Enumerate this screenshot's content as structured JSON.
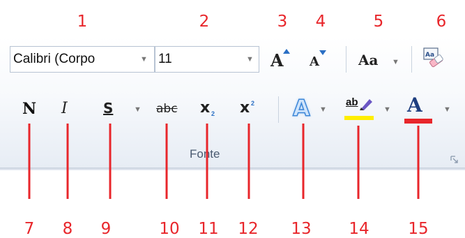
{
  "callout_numbers": [
    "1",
    "2",
    "3",
    "4",
    "5",
    "6",
    "7",
    "8",
    "9",
    "10",
    "11",
    "12",
    "13",
    "14",
    "15"
  ],
  "font": {
    "name_value": "Calibri (Corpo",
    "size_value": "11"
  },
  "buttons": {
    "grow_font_glyph": "A",
    "shrink_font_glyph": "A",
    "change_case_label": "Aa",
    "bold_label": "N",
    "italic_label": "I",
    "underline_label": "S",
    "strikethrough_label": "abc",
    "subscript_base": "x",
    "subscript_small": "2",
    "superscript_base": "x",
    "superscript_small": "2",
    "text_effects_glyph": "A",
    "highlight_label": "ab",
    "font_color_glyph": "A"
  },
  "group_label": "Fonte",
  "colors": {
    "callout": "#e8262b",
    "highlight": "#ffee00",
    "font_color": "#e8262b",
    "accent": "#2a6fc4"
  }
}
